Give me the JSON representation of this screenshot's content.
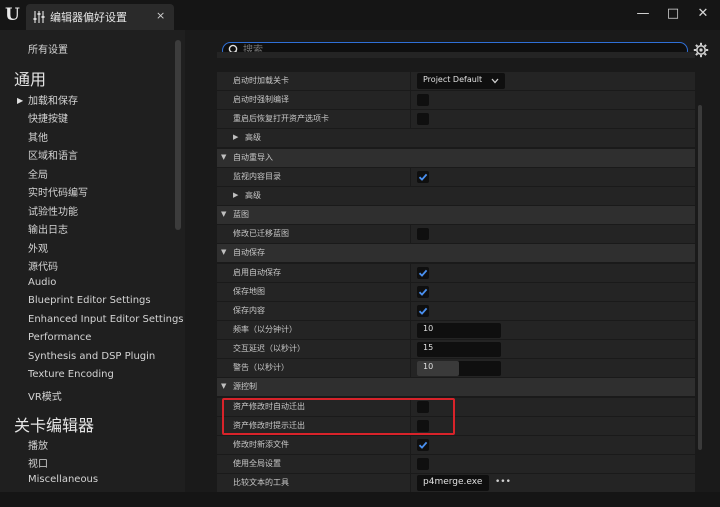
{
  "titlebar": {
    "tab_label": "编辑器偏好设置",
    "close_tab": "×",
    "minimize": "—",
    "maximize": "□",
    "close": "✕"
  },
  "sidebar": {
    "all_settings": "所有设置",
    "section1": "通用",
    "items1": [
      "加载和保存",
      "快捷按键",
      "其他",
      "区域和语言",
      "全局",
      "实时代码编写",
      "试验性功能",
      "输出日志",
      "外观",
      "源代码",
      "Audio",
      "Blueprint Editor Settings",
      "Enhanced Input Editor Settings",
      "Performance",
      "Synthesis and DSP Plugin",
      "Texture Encoding",
      "VR模式"
    ],
    "section2": "关卡编辑器",
    "items2": [
      "播放",
      "视口",
      "Miscellaneous"
    ]
  },
  "search": {
    "placeholder": "搜索"
  },
  "rows": [
    {
      "kind": "row",
      "label": "启动时加载关卡",
      "control": "dropdown",
      "value": "Project Default"
    },
    {
      "kind": "row",
      "label": "启动时强制编译",
      "control": "checkbox",
      "checked": false
    },
    {
      "kind": "row",
      "label": "重启后恢复打开资产选项卡",
      "control": "checkbox",
      "checked": false
    },
    {
      "kind": "sub",
      "label": "高级"
    },
    {
      "kind": "cat",
      "label": "自动重导入"
    },
    {
      "kind": "row",
      "label": "监视内容目录",
      "control": "checkbox",
      "checked": true
    },
    {
      "kind": "sub",
      "label": "高级"
    },
    {
      "kind": "cat",
      "label": "蓝图"
    },
    {
      "kind": "row",
      "label": "修改已迁移蓝图",
      "control": "checkbox",
      "checked": false
    },
    {
      "kind": "cat",
      "label": "自动保存"
    },
    {
      "kind": "row",
      "label": "启用自动保存",
      "control": "checkbox",
      "checked": true
    },
    {
      "kind": "row",
      "label": "保存地图",
      "control": "checkbox",
      "checked": true
    },
    {
      "kind": "row",
      "label": "保存内容",
      "control": "checkbox",
      "checked": true
    },
    {
      "kind": "row",
      "label": "频率（以分钟计）",
      "control": "number",
      "value": "10",
      "fill": 0
    },
    {
      "kind": "row",
      "label": "交互延迟（以秒计）",
      "control": "number",
      "value": "15",
      "fill": 0
    },
    {
      "kind": "row",
      "label": "警告（以秒计）",
      "control": "number",
      "value": "10",
      "fill": 0.5
    },
    {
      "kind": "cat",
      "label": "源控制"
    },
    {
      "kind": "row",
      "label": "资产修改时自动迁出",
      "control": "checkbox",
      "checked": false
    },
    {
      "kind": "row",
      "label": "资产修改时提示迁出",
      "control": "checkbox",
      "checked": false
    },
    {
      "kind": "row",
      "label": "修改时新添文件",
      "control": "checkbox",
      "checked": true
    },
    {
      "kind": "row",
      "label": "使用全局设置",
      "control": "checkbox",
      "checked": false
    },
    {
      "kind": "row",
      "label": "比较文本的工具",
      "control": "text",
      "value": "p4merge.exe",
      "dots": "•••"
    }
  ],
  "colors": {
    "accent": "#2f6fd6",
    "highlight": "#d8232a",
    "check": "#4a90f0"
  },
  "icons": {
    "logo": "unreal-logo-icon",
    "tab": "sliders-icon",
    "search": "search-icon",
    "settings": "gear-icon"
  }
}
